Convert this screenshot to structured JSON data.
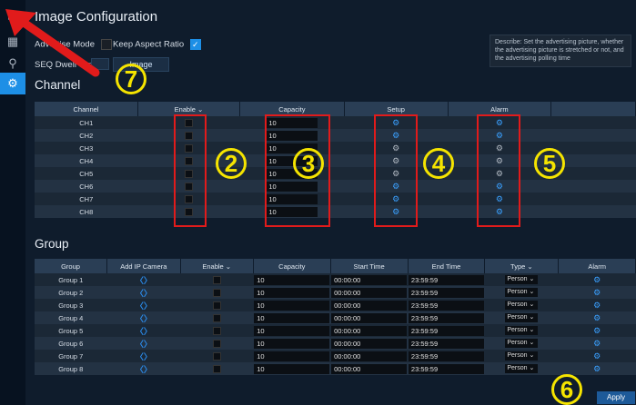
{
  "title": "Image Configuration",
  "options": {
    "advertise_label": "Advertise Mode",
    "keep_aspect_label": "Keep Aspect Ratio",
    "seq_label": "SEQ Dwell Time",
    "image_button": "Image"
  },
  "description": "Describe: Set the advertising picture, whether the advertising picture is stretched or not, and the advertising polling time",
  "channel": {
    "section_title": "Channel",
    "headers": [
      "Channel",
      "Enable",
      "Capacity",
      "Setup",
      "Alarm"
    ],
    "rows": [
      {
        "name": "CH1",
        "capacity": "10",
        "setup": "blue",
        "alarm": "blue"
      },
      {
        "name": "CH2",
        "capacity": "10",
        "setup": "blue",
        "alarm": "blue"
      },
      {
        "name": "CH3",
        "capacity": "10",
        "setup": "grey",
        "alarm": "grey"
      },
      {
        "name": "CH4",
        "capacity": "10",
        "setup": "grey",
        "alarm": "grey"
      },
      {
        "name": "CH5",
        "capacity": "10",
        "setup": "grey",
        "alarm": "grey"
      },
      {
        "name": "CH6",
        "capacity": "10",
        "setup": "blue",
        "alarm": "blue"
      },
      {
        "name": "CH7",
        "capacity": "10",
        "setup": "blue",
        "alarm": "blue"
      },
      {
        "name": "CH8",
        "capacity": "10",
        "setup": "blue",
        "alarm": "blue"
      }
    ]
  },
  "group": {
    "section_title": "Group",
    "headers": [
      "Group",
      "Add IP Camera",
      "Enable",
      "Capacity",
      "Start Time",
      "End Time",
      "Type",
      "Alarm"
    ],
    "rows": [
      {
        "name": "Group 1",
        "capacity": "10",
        "start": "00:00:00",
        "end": "23:59:59",
        "type": "Person"
      },
      {
        "name": "Group 2",
        "capacity": "10",
        "start": "00:00:00",
        "end": "23:59:59",
        "type": "Person"
      },
      {
        "name": "Group 3",
        "capacity": "10",
        "start": "00:00:00",
        "end": "23:59:59",
        "type": "Person"
      },
      {
        "name": "Group 4",
        "capacity": "10",
        "start": "00:00:00",
        "end": "23:59:59",
        "type": "Person"
      },
      {
        "name": "Group 5",
        "capacity": "10",
        "start": "00:00:00",
        "end": "23:59:59",
        "type": "Person"
      },
      {
        "name": "Group 6",
        "capacity": "10",
        "start": "00:00:00",
        "end": "23:59:59",
        "type": "Person"
      },
      {
        "name": "Group 7",
        "capacity": "10",
        "start": "00:00:00",
        "end": "23:59:59",
        "type": "Person"
      },
      {
        "name": "Group 8",
        "capacity": "10",
        "start": "00:00:00",
        "end": "23:59:59",
        "type": "Person"
      }
    ]
  },
  "apply_label": "Apply",
  "callouts": [
    "7",
    "2",
    "3",
    "4",
    "5",
    "6"
  ],
  "colors": {
    "accent": "#1d8fe6",
    "highlight": "#e11b1b",
    "callout": "#f5e400"
  }
}
